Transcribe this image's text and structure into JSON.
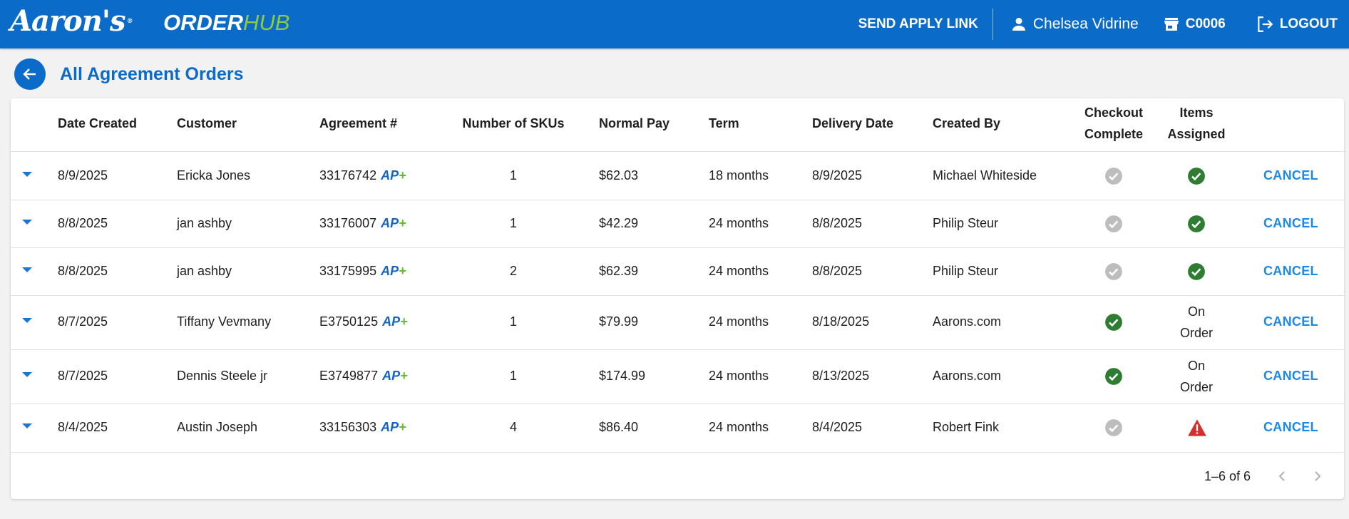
{
  "header": {
    "brand": "Aaron's",
    "brand_mark": "®",
    "app_name_part1": "ORDER",
    "app_name_part2": "HUB",
    "send_apply_link": "SEND APPLY LINK",
    "user_name": "Chelsea Vidrine",
    "store_code": "C0006",
    "logout": "LOGOUT"
  },
  "page": {
    "title": "All Agreement Orders"
  },
  "table": {
    "headers": {
      "date_created": "Date Created",
      "customer": "Customer",
      "agreement": "Agreement #",
      "skus": "Number of SKUs",
      "normal_pay": "Normal Pay",
      "term": "Term",
      "delivery_date": "Delivery Date",
      "created_by": "Created By",
      "checkout_line1": "Checkout",
      "checkout_line2": "Complete",
      "items_line1": "Items",
      "items_line2": "Assigned"
    },
    "ap_badge_a": "AP",
    "ap_badge_plus": "+",
    "cancel_label": "CANCEL",
    "rows": [
      {
        "date": "8/9/2025",
        "customer": "Ericka Jones",
        "agreement": "33176742",
        "skus": "1",
        "pay": "$62.03",
        "term": "18 months",
        "delivery": "8/9/2025",
        "created_by": "Michael Whiteside",
        "checkout": "pending",
        "items": "check"
      },
      {
        "date": "8/8/2025",
        "customer": "jan ashby",
        "agreement": "33176007",
        "skus": "1",
        "pay": "$42.29",
        "term": "24 months",
        "delivery": "8/8/2025",
        "created_by": "Philip Steur",
        "checkout": "pending",
        "items": "check"
      },
      {
        "date": "8/8/2025",
        "customer": "jan ashby",
        "agreement": "33175995",
        "skus": "2",
        "pay": "$62.39",
        "term": "24 months",
        "delivery": "8/8/2025",
        "created_by": "Philip Steur",
        "checkout": "pending",
        "items": "check"
      },
      {
        "date": "8/7/2025",
        "customer": "Tiffany Vevmany",
        "agreement": "E3750125",
        "skus": "1",
        "pay": "$79.99",
        "term": "24 months",
        "delivery": "8/18/2025",
        "created_by": "Aarons.com",
        "checkout": "check",
        "items": "On Order",
        "items_line1": "On",
        "items_line2": "Order"
      },
      {
        "date": "8/7/2025",
        "customer": "Dennis Steele jr",
        "agreement": "E3749877",
        "skus": "1",
        "pay": "$174.99",
        "term": "24 months",
        "delivery": "8/13/2025",
        "created_by": "Aarons.com",
        "checkout": "check",
        "items": "On Order",
        "items_line1": "On",
        "items_line2": "Order"
      },
      {
        "date": "8/4/2025",
        "customer": "Austin Joseph",
        "agreement": "33156303",
        "skus": "4",
        "pay": "$86.40",
        "term": "24 months",
        "delivery": "8/4/2025",
        "created_by": "Robert Fink",
        "checkout": "pending",
        "items": "warning"
      }
    ]
  },
  "pagination": {
    "range_text": "1–6 of 6"
  },
  "colors": {
    "brand_blue": "#0b6bc8",
    "hub_green": "#8ccb3b",
    "link_blue": "#1e88e5",
    "check_green": "#2e7d32",
    "pending_gray": "#bdbdbd",
    "warning_red": "#d32f2f"
  },
  "icons": {
    "user": "person-icon",
    "store": "storefront-icon",
    "logout": "logout-icon",
    "back": "arrow-left-icon",
    "expand": "caret-down-icon",
    "prev": "chevron-left-icon",
    "next": "chevron-right-icon"
  }
}
